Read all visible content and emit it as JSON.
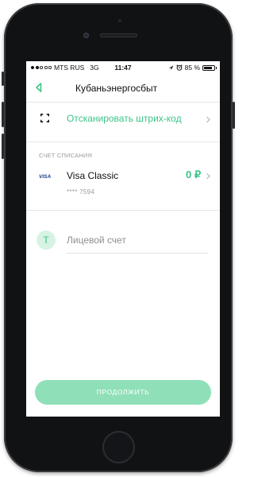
{
  "status_bar": {
    "carrier": "MTS RUS",
    "network": "3G",
    "time": "11:47",
    "battery": "85 %",
    "battery_level": 0.85
  },
  "nav": {
    "title": "Кубаньэнергосбыт",
    "back_icon": "back-chevron-icon"
  },
  "scan": {
    "label": "Отсканировать штрих-код",
    "icon": "barcode-scan-icon"
  },
  "payment": {
    "section_label": "СЧЕТ СПИСАНИЯ",
    "card_brand": "VISA",
    "card_name": "Visa Classic",
    "card_number": "**** 7594",
    "balance": "0 ₽"
  },
  "account": {
    "avatar_letter": "Т",
    "placeholder": "Лицевой счет"
  },
  "continue_label": "ПРОДОЛЖИТЬ",
  "colors": {
    "accent": "#3cc488",
    "button": "#8fe0b8",
    "avatar_bg": "#d6f3e4"
  }
}
